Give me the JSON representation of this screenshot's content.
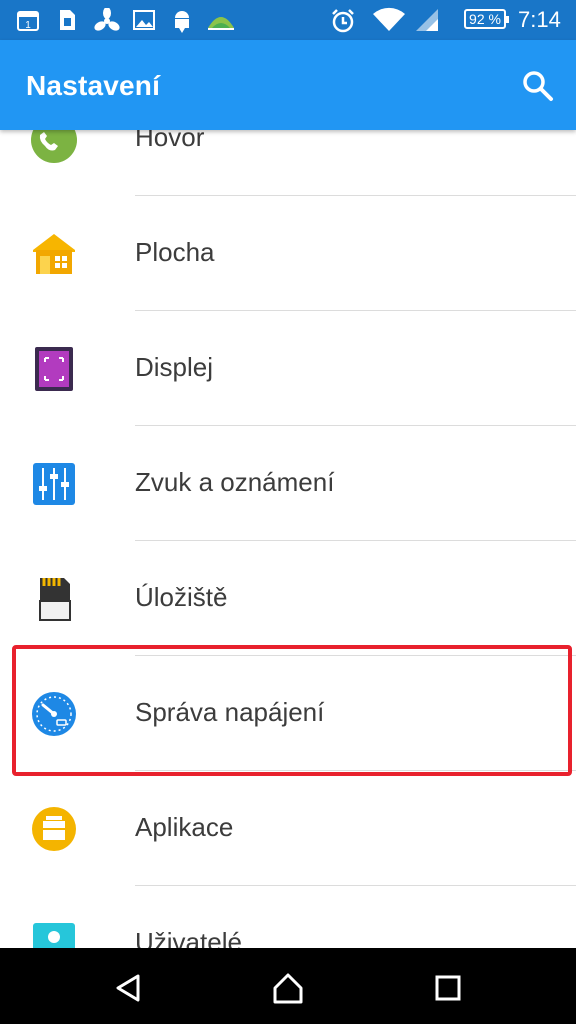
{
  "status_bar": {
    "battery_percent": "92 %",
    "time": "7:14",
    "icons": [
      "calendar-icon",
      "sim-icon",
      "fan-icon",
      "image-icon",
      "android-download-icon",
      "landscape-icon",
      "alarm-icon",
      "wifi-icon",
      "signal-icon",
      "battery-icon"
    ]
  },
  "app_bar": {
    "title": "Nastavení",
    "search_icon": "search-icon",
    "color": "#2196f3"
  },
  "settings": {
    "items": [
      {
        "label": "Hovor",
        "icon": "phone-icon"
      },
      {
        "label": "Plocha",
        "icon": "home-screen-icon"
      },
      {
        "label": "Displej",
        "icon": "display-icon"
      },
      {
        "label": "Zvuk a oznámení",
        "icon": "sound-sliders-icon"
      },
      {
        "label": "Úložiště",
        "icon": "sd-card-icon"
      },
      {
        "label": "Správa napájení",
        "icon": "power-gauge-icon"
      },
      {
        "label": "Aplikace",
        "icon": "apps-icon"
      },
      {
        "label": "Uživatelé",
        "icon": "users-icon"
      }
    ]
  },
  "highlight_color": "#e8212d",
  "nav_bar": {
    "icons": [
      "back-icon",
      "home-icon",
      "recents-icon"
    ]
  }
}
